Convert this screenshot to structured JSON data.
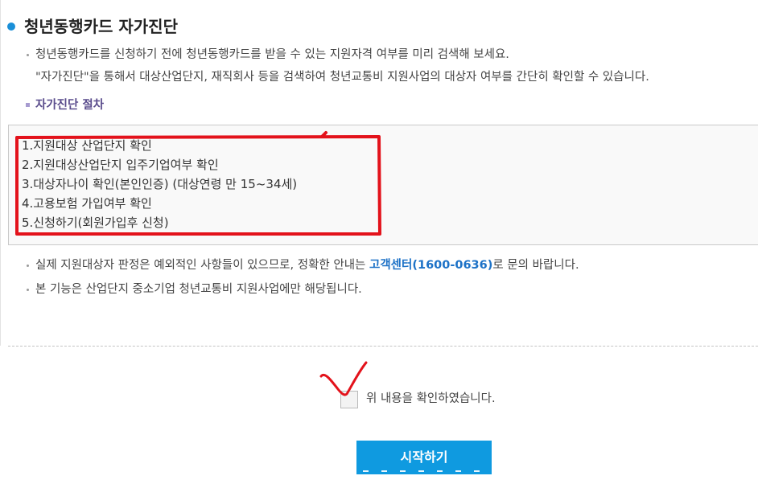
{
  "page": {
    "title": "청년동행카드 자가진단"
  },
  "intro": {
    "lines": [
      "청년동행카드를 신청하기 전에 청년동행카드를 받을 수 있는 지원자격 여부를 미리 검색해 보세요.",
      "\"자가진단\"을 통해서 대상산업단지, 재직회사 등을 검색하여 청년교통비 지원사업의 대상자 여부를 간단히 확인할 수 있습니다."
    ]
  },
  "procedure": {
    "heading": "자가진단 절차",
    "steps": [
      "1.지원대상 산업단지 확인",
      "2.지원대상산업단지 입주기업여부 확인",
      "3.대상자나이 확인(본인인증) (대상연령 만 15~34세)",
      "4.고용보험 가입여부 확인",
      "5.신청하기(회원가입후 신청)"
    ]
  },
  "notes": [
    {
      "before": "실제 지원대상자 판정은 예외적인 사항들이 있으므로, 정확한 안내는 ",
      "link": "고객센터(1600-0636)",
      "after": "로 문의 바랍니다."
    },
    {
      "text": "본 기능은 산업단지 중소기업 청년교통비 지원사업에만 해당됩니다."
    }
  ],
  "agreement": {
    "label": "위 내용을 확인하였습니다.",
    "checked": false
  },
  "start_button": {
    "label": "시작하기"
  },
  "icons": {
    "title_bullet": "blue-dot-bullet-icon",
    "subheading_bullet": "purple-square-bullet-icon",
    "list_bullet": "gray-dot-bullet-icon"
  },
  "colors": {
    "title_bullet": "#1a8fd8",
    "subheading": "#5a4c8c",
    "link": "#1d72c7",
    "button": "#0f9ae0",
    "annotation": "#e3121b"
  }
}
